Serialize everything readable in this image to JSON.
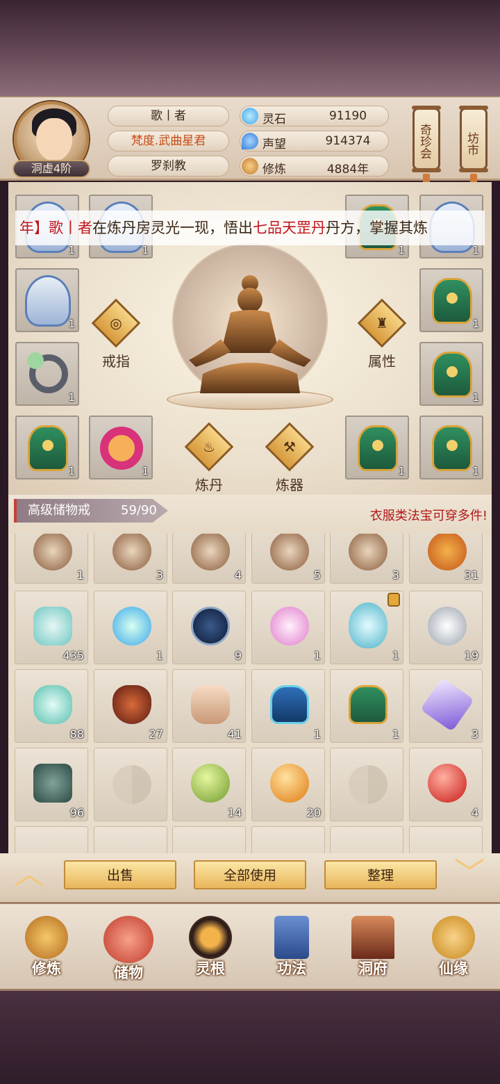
{
  "player": {
    "name": "歌丨者",
    "title": "梵度.武曲星君",
    "sect": "罗刹教",
    "rank": "洞虚4阶"
  },
  "stats": [
    {
      "label": "灵石",
      "value": "91190",
      "icon": "spirit-stone-icon",
      "color": "#3aa7e8"
    },
    {
      "label": "声望",
      "value": "914374",
      "icon": "reputation-icon",
      "color": "#2f7fd8"
    },
    {
      "label": "修炼",
      "value": "4884年",
      "icon": "cultivation-icon",
      "color": "#e0a040"
    }
  ],
  "shortcuts": {
    "treasure_fair": "奇珍会",
    "market": "坊市"
  },
  "ticker": {
    "part1": "年】",
    "name": "歌丨者",
    "part2": "在炼丹房灵光一现，悟出",
    "pill": "七品天罡丹",
    "part3": "丹方，掌握其炼"
  },
  "equipment": {
    "counts": [
      "1",
      "1",
      "1",
      "1",
      "1",
      "1",
      "1",
      "1",
      "1",
      "1",
      "1",
      "1"
    ],
    "functions": {
      "ring": "戒指",
      "attributes": "属性",
      "alchemy": "炼丹",
      "forging": "炼器"
    }
  },
  "bag": {
    "name": "高级储物戒",
    "capacity": "59/90",
    "tip": "衣服类法宝可穿多件!",
    "rows": [
      [
        "1",
        "3",
        "4",
        "5",
        "3",
        "31"
      ],
      [
        "435",
        "1",
        "9",
        "1",
        "1",
        "19"
      ],
      [
        "88",
        "27",
        "41",
        "1",
        "1",
        "3"
      ],
      [
        "96",
        "",
        "14",
        "20",
        "",
        "4"
      ]
    ]
  },
  "actions": {
    "sell": "出售",
    "use_all": "全部使用",
    "sort": "整理"
  },
  "nav": [
    "修炼",
    "储物",
    "灵根",
    "功法",
    "洞府",
    "仙缘"
  ],
  "colors": {
    "accent_red": "#c0161c",
    "gold": "#e9b65a",
    "panel": "#e8dccb"
  }
}
